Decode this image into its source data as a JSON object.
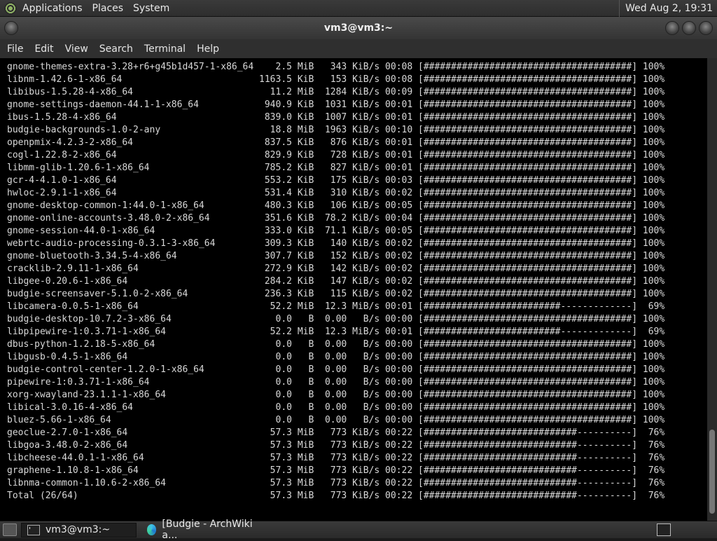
{
  "top_panel": {
    "menus": [
      "Applications",
      "Places",
      "System"
    ],
    "clock": "Wed Aug  2, 19:31"
  },
  "window": {
    "title": "vm3@vm3:~"
  },
  "menubar": [
    "File",
    "Edit",
    "View",
    "Search",
    "Terminal",
    "Help"
  ],
  "terminal": {
    "lines": [
      "gnome-themes-extra-3.28+r6+g45b1d457-1-x86_64    2.5 MiB   343 KiB/s 00:08 [######################################] 100%",
      "libnm-1.42.6-1-x86_64                         1163.5 KiB   153 KiB/s 00:08 [######################################] 100%",
      "libibus-1.5.28-4-x86_64                         11.2 MiB  1284 KiB/s 00:09 [######################################] 100%",
      "gnome-settings-daemon-44.1-1-x86_64            940.9 KiB  1031 KiB/s 00:01 [######################################] 100%",
      "ibus-1.5.28-4-x86_64                           839.0 KiB  1007 KiB/s 00:01 [######################################] 100%",
      "budgie-backgrounds-1.0-2-any                    18.8 MiB  1963 KiB/s 00:10 [######################################] 100%",
      "openpmix-4.2.3-2-x86_64                        837.5 KiB   876 KiB/s 00:01 [######################################] 100%",
      "cogl-1.22.8-2-x86_64                           829.9 KiB   728 KiB/s 00:01 [######################################] 100%",
      "libmm-glib-1.20.6-1-x86_64                     785.2 KiB   827 KiB/s 00:01 [######################################] 100%",
      "gcr-4-4.1.0-1-x86_64                           553.2 KiB   175 KiB/s 00:03 [######################################] 100%",
      "hwloc-2.9.1-1-x86_64                           531.4 KiB   310 KiB/s 00:02 [######################################] 100%",
      "gnome-desktop-common-1:44.0-1-x86_64           480.3 KiB   106 KiB/s 00:05 [######################################] 100%",
      "gnome-online-accounts-3.48.0-2-x86_64          351.6 KiB  78.2 KiB/s 00:04 [######################################] 100%",
      "gnome-session-44.0-1-x86_64                    333.0 KiB  71.1 KiB/s 00:05 [######################################] 100%",
      "webrtc-audio-processing-0.3.1-3-x86_64         309.3 KiB   140 KiB/s 00:02 [######################################] 100%",
      "gnome-bluetooth-3.34.5-4-x86_64                307.7 KiB   152 KiB/s 00:02 [######################################] 100%",
      "cracklib-2.9.11-1-x86_64                       272.9 KiB   142 KiB/s 00:02 [######################################] 100%",
      "libgee-0.20.6-1-x86_64                         284.2 KiB   147 KiB/s 00:02 [######################################] 100%",
      "budgie-screensaver-5.1.0-2-x86_64              236.3 KiB   115 KiB/s 00:02 [######################################] 100%",
      "libcamera-0.0.5-1-x86_64                        52.2 MiB  12.3 MiB/s 00:01 [#########################-------------]  69%",
      "budgie-desktop-10.7.2-3-x86_64                   0.0   B  0.00   B/s 00:00 [######################################] 100%",
      "libpipewire-1:0.3.71-1-x86_64                   52.2 MiB  12.3 MiB/s 00:01 [#########################-------------]  69%",
      "dbus-python-1.2.18-5-x86_64                      0.0   B  0.00   B/s 00:00 [######################################] 100%",
      "libgusb-0.4.5-1-x86_64                           0.0   B  0.00   B/s 00:00 [######################################] 100%",
      "budgie-control-center-1.2.0-1-x86_64             0.0   B  0.00   B/s 00:00 [######################################] 100%",
      "pipewire-1:0.3.71-1-x86_64                       0.0   B  0.00   B/s 00:00 [######################################] 100%",
      "xorg-xwayland-23.1.1-1-x86_64                    0.0   B  0.00   B/s 00:00 [######################################] 100%",
      "libical-3.0.16-4-x86_64                          0.0   B  0.00   B/s 00:00 [######################################] 100%",
      "bluez-5.66-1-x86_64                              0.0   B  0.00   B/s 00:00 [######################################] 100%",
      "geoclue-2.7.0-1-x86_64                          57.3 MiB   773 KiB/s 00:22 [############################----------]  76%",
      "libgoa-3.48.0-2-x86_64                          57.3 MiB   773 KiB/s 00:22 [############################----------]  76%",
      "libcheese-44.0.1-1-x86_64                       57.3 MiB   773 KiB/s 00:22 [############################----------]  76%",
      "graphene-1.10.8-1-x86_64                        57.3 MiB   773 KiB/s 00:22 [############################----------]  76%",
      "libnma-common-1.10.6-2-x86_64                   57.3 MiB   773 KiB/s 00:22 [############################----------]  76%",
      "Total (26/64)                                   57.3 MiB   773 KiB/s 00:22 [############################----------]  76%"
    ]
  },
  "taskbar": {
    "tasks": [
      "vm3@vm3:~",
      "[Budgie - ArchWiki a..."
    ]
  }
}
